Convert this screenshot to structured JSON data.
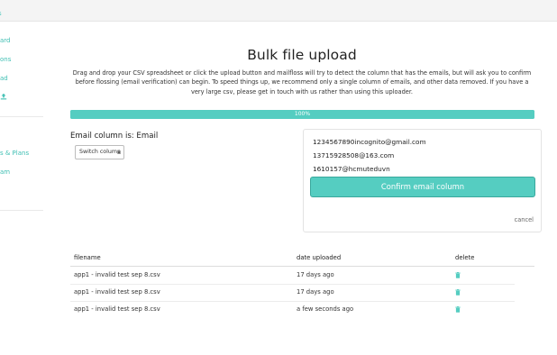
{
  "topbar": {
    "brand": "s"
  },
  "sidebar": {
    "items": [
      {
        "label": "ard",
        "icon": null
      },
      {
        "label": "ons",
        "icon": null
      },
      {
        "label": "ad",
        "icon": null
      },
      {
        "label": "",
        "icon": "upload-icon"
      },
      {
        "label": "s & Plans",
        "icon": null
      },
      {
        "label": "am",
        "icon": null
      }
    ]
  },
  "page": {
    "title": "Bulk file upload",
    "intro": "Drag and drop your CSV spreadsheet or click the upload button and mailfloss will try to detect the column that has the emails, but will ask you to confirm before flossing (email verification) can begin. To speed things up, we recommend only a single column of emails, and other data removed. If you have a very large csv, please get in touch with us rather than using this uploader."
  },
  "progress": {
    "value": 1.0,
    "label": "100%"
  },
  "detect": {
    "email_column_label": "Email column is: Email",
    "switch_label": "Switch column",
    "emails": [
      "1234567890incognito@gmail.com",
      "13715928508@163.com",
      "1610157@hcmuteduvn"
    ],
    "confirm_label": "Confirm email column",
    "cancel_label": "cancel"
  },
  "table": {
    "headers": [
      "filename",
      "date uploaded",
      "delete"
    ],
    "rows": [
      {
        "filename": "app1 - invalid test sep 8.csv",
        "date": "17 days ago"
      },
      {
        "filename": "app1 - invalid test sep 8.csv",
        "date": "17 days ago"
      },
      {
        "filename": "app1 - invalid test sep 8.csv",
        "date": "a few seconds ago"
      }
    ]
  },
  "colors": {
    "accent": "#55cdc1",
    "accent_border": "#3aa89d",
    "link": "#3fbfb3"
  }
}
